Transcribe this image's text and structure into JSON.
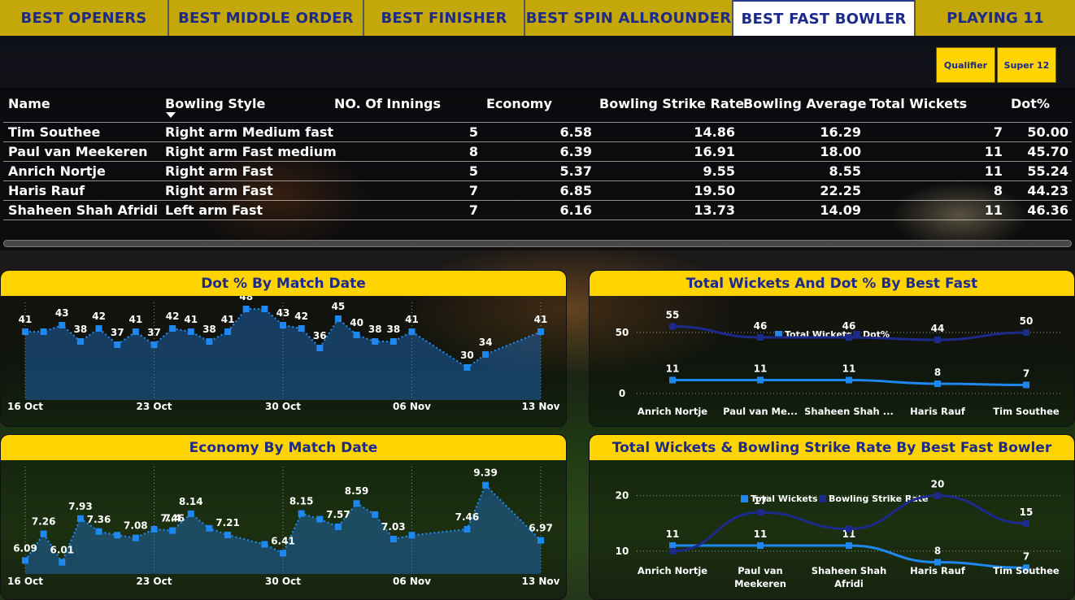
{
  "tabs": [
    {
      "label": "BEST OPENERS",
      "active": false
    },
    {
      "label": "BEST MIDDLE ORDER",
      "active": false
    },
    {
      "label": "BEST FINISHER",
      "active": false
    },
    {
      "label": "BEST SPIN ALLROUNDER",
      "active": false
    },
    {
      "label": "BEST FAST BOWLER",
      "active": true
    },
    {
      "label": "PLAYING 11",
      "active": false
    }
  ],
  "filters": [
    {
      "label": "Qualifier"
    },
    {
      "label": "Super 12"
    }
  ],
  "table": {
    "columns": [
      "Name",
      "Bowling Style",
      "NO. Of Innings",
      "Economy",
      "Bowling Strike Rate",
      "Bowling Average",
      "Total Wickets",
      "Dot%"
    ],
    "rows": [
      [
        "Tim Southee",
        "Right arm Medium fast",
        "5",
        "6.58",
        "14.86",
        "16.29",
        "7",
        "50.00"
      ],
      [
        "Paul van Meekeren",
        "Right arm Fast medium",
        "8",
        "6.39",
        "16.91",
        "18.00",
        "11",
        "45.70"
      ],
      [
        "Anrich Nortje",
        "Right arm Fast",
        "5",
        "5.37",
        "9.55",
        "8.55",
        "11",
        "55.24"
      ],
      [
        "Haris Rauf",
        "Right arm Fast",
        "7",
        "6.85",
        "19.50",
        "22.25",
        "8",
        "44.23"
      ],
      [
        "Shaheen Shah Afridi",
        "Left arm Fast",
        "7",
        "6.16",
        "13.73",
        "14.09",
        "11",
        "46.36"
      ]
    ]
  },
  "colors": {
    "accent": "#ffd400",
    "title_text": "#1d2a8a",
    "series_light": "#1e7fe6",
    "series_dark": "#1c2a8c"
  },
  "chart_data": [
    {
      "type": "area",
      "title": "Dot % By Match Date",
      "x_ticks": [
        "16 Oct",
        "23 Oct",
        "30 Oct",
        "06 Nov",
        "13 Nov"
      ],
      "x": [
        "2022-10-16",
        "2022-10-17",
        "2022-10-18",
        "2022-10-19",
        "2022-10-20",
        "2022-10-21",
        "2022-10-22",
        "2022-10-23",
        "2022-10-24",
        "2022-10-25",
        "2022-10-26",
        "2022-10-27",
        "2022-10-28",
        "2022-10-29",
        "2022-10-30",
        "2022-10-31",
        "2022-11-01",
        "2022-11-02",
        "2022-11-03",
        "2022-11-04",
        "2022-11-05",
        "2022-11-06",
        "2022-11-09",
        "2022-11-10",
        "2022-11-13"
      ],
      "values": [
        41,
        41,
        43,
        38,
        42,
        37,
        41,
        37,
        42,
        41,
        38,
        41,
        48,
        48,
        43,
        42,
        36,
        45,
        40,
        38,
        38,
        41,
        30,
        34,
        41
      ],
      "labels_shown": [
        true,
        false,
        true,
        true,
        true,
        true,
        true,
        true,
        true,
        true,
        true,
        true,
        true,
        false,
        true,
        true,
        true,
        true,
        true,
        true,
        true,
        true,
        true,
        true,
        true
      ]
    },
    {
      "type": "line",
      "title": "Total Wickets And Dot % By Best Fast",
      "categories": [
        "Anrich Nortje",
        "Paul van Me...",
        "Shaheen Shah ...",
        "Haris Rauf",
        "Tim Southee"
      ],
      "series": [
        {
          "name": "Total Wickets",
          "values": [
            11,
            11,
            11,
            8,
            7
          ]
        },
        {
          "name": "Dot%",
          "values": [
            55,
            46,
            46,
            44,
            50
          ]
        }
      ],
      "y_ticks": [
        "0",
        "50"
      ],
      "ylim": [
        0,
        60
      ],
      "legend": "top-center"
    },
    {
      "type": "area",
      "title": "Economy By Match Date",
      "x_ticks": [
        "16 Oct",
        "23 Oct",
        "30 Oct",
        "06 Nov",
        "13 Nov"
      ],
      "x": [
        "2022-10-16",
        "2022-10-17",
        "2022-10-18",
        "2022-10-19",
        "2022-10-20",
        "2022-10-21",
        "2022-10-22",
        "2022-10-23",
        "2022-10-24",
        "2022-10-25",
        "2022-10-26",
        "2022-10-27",
        "2022-10-29",
        "2022-10-30",
        "2022-10-31",
        "2022-11-01",
        "2022-11-02",
        "2022-11-03",
        "2022-11-04",
        "2022-11-05",
        "2022-11-06",
        "2022-11-09",
        "2022-11-10",
        "2022-11-13"
      ],
      "values": [
        6.09,
        7.26,
        6.01,
        7.93,
        7.36,
        7.2,
        7.08,
        7.46,
        7.4,
        8.14,
        7.5,
        7.21,
        6.8,
        6.41,
        8.15,
        7.9,
        7.57,
        8.59,
        8.1,
        7.03,
        7.2,
        7.46,
        9.39,
        6.97
      ],
      "labels_shown": [
        true,
        true,
        true,
        true,
        true,
        false,
        true,
        false,
        true,
        true,
        false,
        true,
        false,
        true,
        true,
        false,
        true,
        true,
        false,
        true,
        false,
        true,
        true,
        true
      ],
      "extra_label": {
        "index": 8,
        "text": "7.46"
      }
    },
    {
      "type": "line",
      "title": "Total Wickets & Bowling Strike Rate By Best Fast Bowler",
      "categories": [
        "Anrich Nortje",
        "Paul van Meekeren",
        "Shaheen Shah Afridi",
        "Haris Rauf",
        "Tim Southee"
      ],
      "series": [
        {
          "name": "Total Wickets",
          "values": [
            11,
            11,
            11,
            8,
            7
          ]
        },
        {
          "name": "Bowling Strike Rate",
          "values": [
            10,
            17,
            14,
            20,
            15
          ]
        }
      ],
      "point_labels": {
        "Total Wickets": [
          "11",
          "11",
          "11",
          "8",
          "7"
        ],
        "Bowling Strike Rate": [
          "",
          "17",
          "",
          "20",
          "15"
        ]
      },
      "y_ticks": [
        "10",
        "20"
      ],
      "ylim": [
        5,
        22
      ],
      "legend": "top-center"
    }
  ]
}
